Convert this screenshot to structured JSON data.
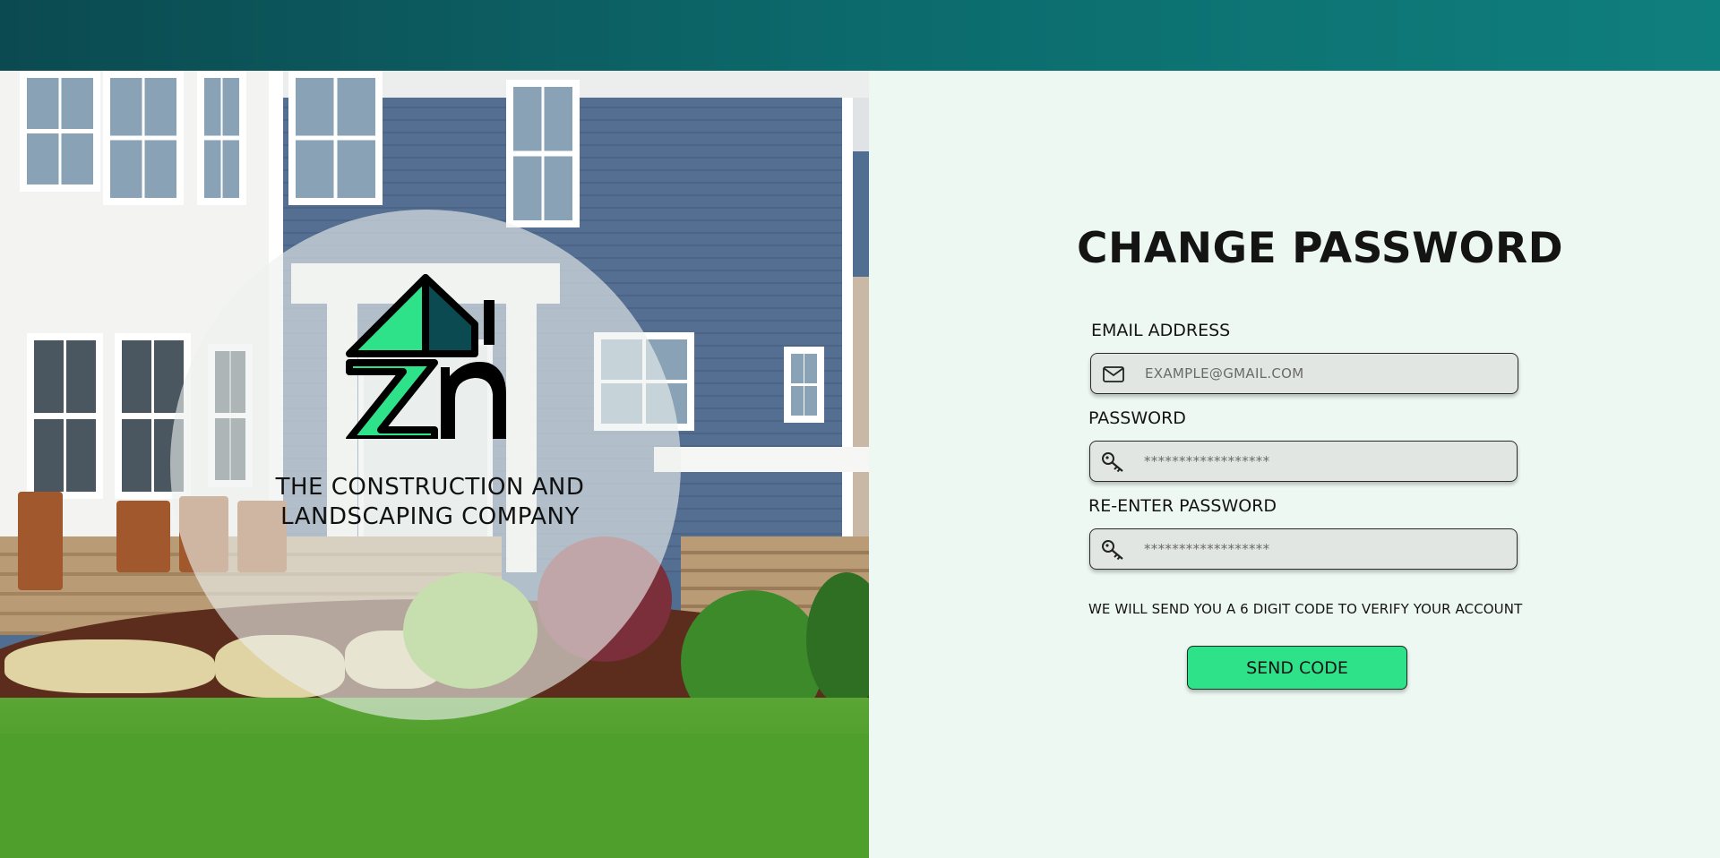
{
  "brand": {
    "company_name_line1": "THE CONSTRUCTION AND",
    "company_name_line2": "LANDSCAPING COMPANY",
    "logo_letters": "ZN",
    "colors": {
      "accent_green": "#2ee28a",
      "logo_dark": "#0b4a50",
      "header": "#0c6a6c"
    }
  },
  "form": {
    "title": "CHANGE PASSWORD",
    "email": {
      "label": "EMAIL ADDRESS",
      "placeholder": "EXAMPLE@GMAIL.COM",
      "value": "",
      "icon": "mail-icon"
    },
    "password": {
      "label": "PASSWORD",
      "placeholder": "******************",
      "value": "",
      "icon": "key-icon"
    },
    "reenter_password": {
      "label": "RE-ENTER PASSWORD",
      "placeholder": "******************",
      "value": "",
      "icon": "key-icon"
    },
    "note": "WE WILL SEND YOU A 6 DIGIT CODE TO VERIFY YOUR ACCOUNT",
    "submit_label": "SEND CODE"
  }
}
